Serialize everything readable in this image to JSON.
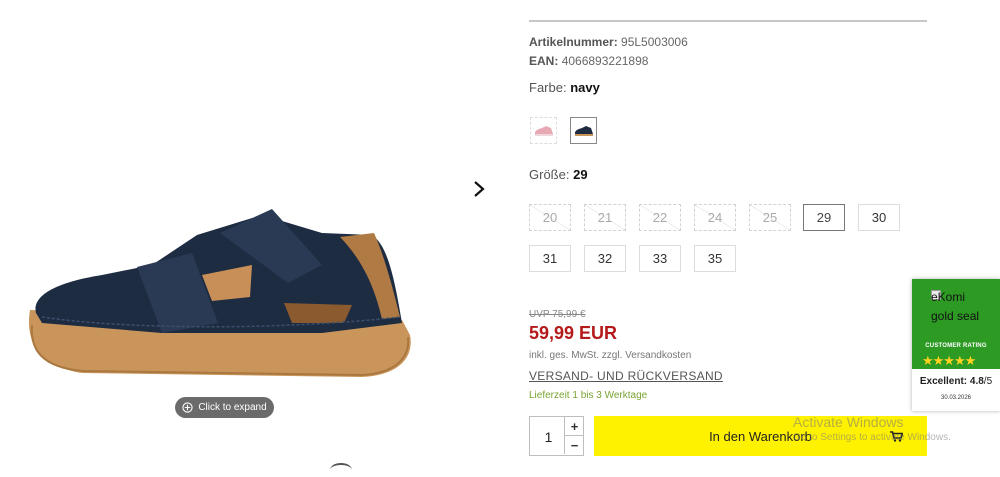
{
  "product": {
    "article_number_label": "Artikelnummer:",
    "article_number": "95L5003006",
    "ean_label": "EAN:",
    "ean": "4066893221898",
    "color_label": "Farbe:",
    "color_value": "navy",
    "swatches": [
      {
        "name": "pink",
        "selected": false
      },
      {
        "name": "navy",
        "selected": true
      }
    ],
    "size_label": "Größe:",
    "size_value": "29",
    "sizes_row1": [
      {
        "label": "20",
        "available": false,
        "selected": false
      },
      {
        "label": "21",
        "available": false,
        "selected": false
      },
      {
        "label": "22",
        "available": false,
        "selected": false
      },
      {
        "label": "24",
        "available": false,
        "selected": false
      },
      {
        "label": "25",
        "available": false,
        "selected": false
      },
      {
        "label": "29",
        "available": true,
        "selected": true
      },
      {
        "label": "30",
        "available": true,
        "selected": false
      }
    ],
    "sizes_row2": [
      {
        "label": "31",
        "available": true,
        "selected": false
      },
      {
        "label": "32",
        "available": true,
        "selected": false
      },
      {
        "label": "33",
        "available": true,
        "selected": false
      },
      {
        "label": "35",
        "available": true,
        "selected": false
      }
    ],
    "uvp": "UVP 75,99 €",
    "price": "59,99 EUR",
    "tax_note": "inkl. ges. MwSt. zzgl. Versandkosten",
    "shipping_link": "VERSAND- UND RÜCKVERSAND",
    "delivery_time": "Lieferzeit 1 bis 3 Werktage",
    "quantity": "1",
    "qty_plus": "+",
    "qty_minus": "−",
    "add_to_cart": "In den Warenkorb"
  },
  "gallery": {
    "expand_label": "Click to expand"
  },
  "ekomi": {
    "seal_alt": "eKomi gold seal",
    "rating_label": "CUSTOMER RATING",
    "stars": "★★★★★",
    "score_label": "Excellent:",
    "score": "4.8",
    "score_max": "/5",
    "date": "30.03.2026"
  },
  "watermark": {
    "title": "Activate Windows",
    "subtitle": "Go to Settings to activate Windows."
  },
  "colors": {
    "price_red": "#b51a1a",
    "cart_yellow": "#fff200",
    "ekomi_green": "#2d9a24",
    "delivery_green": "#7aa331"
  }
}
